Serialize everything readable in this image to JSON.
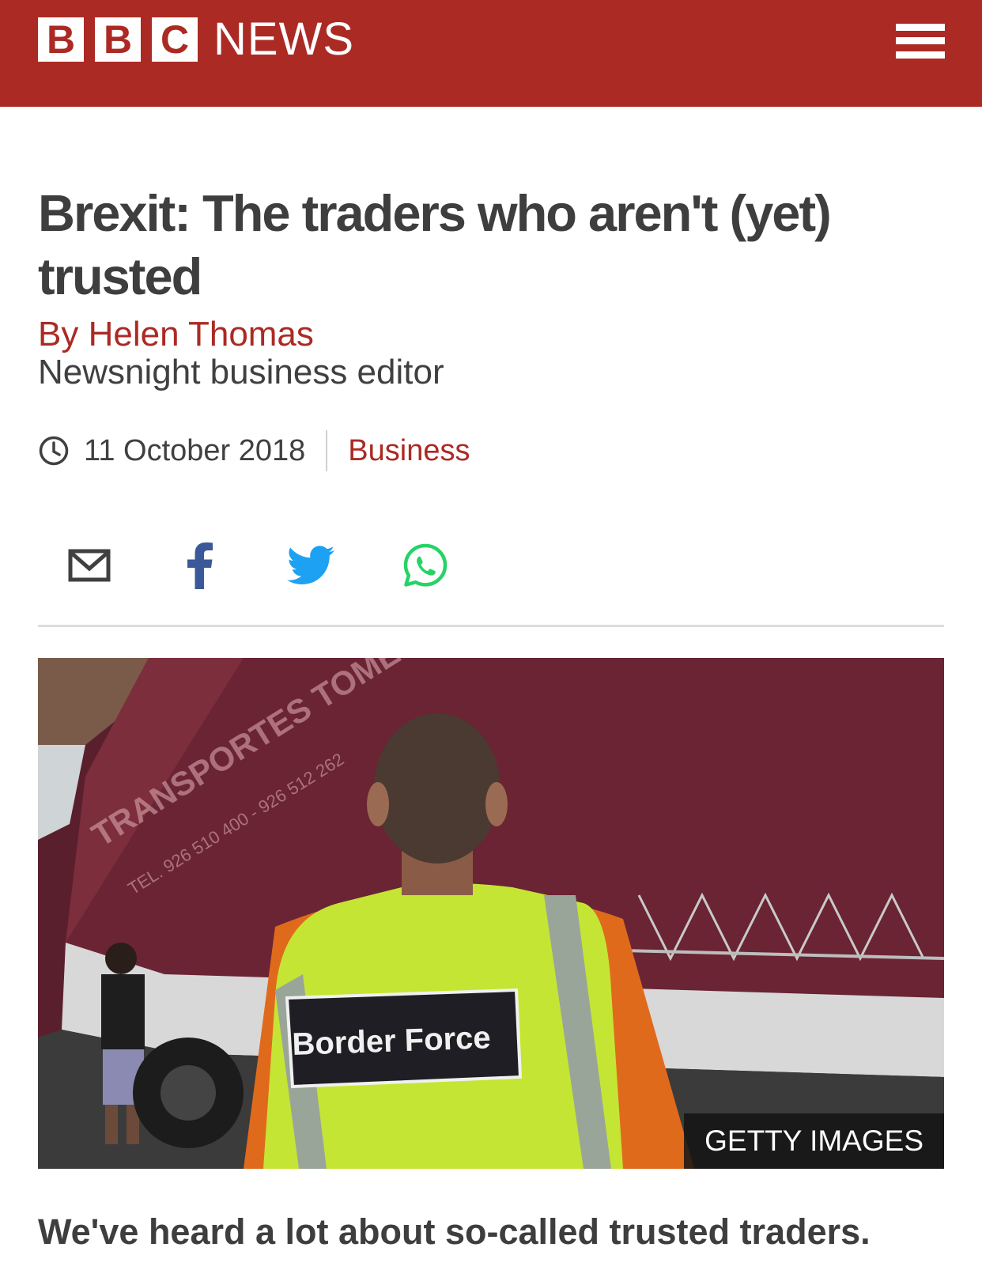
{
  "header": {
    "logo_letters": [
      "B",
      "B",
      "C"
    ],
    "logo_word": "NEWS",
    "menu_icon": "hamburger-menu-icon",
    "background_color": "#ab2a24"
  },
  "article": {
    "headline": "Brexit: The traders who aren't (yet) trusted",
    "byline": "By Helen Thomas",
    "role": "Newsnight business editor",
    "date": "11 October 2018",
    "section": "Business",
    "intro": "We've heard a lot about so-called trusted traders."
  },
  "share": {
    "icons": [
      "email-icon",
      "facebook-icon",
      "twitter-icon",
      "whatsapp-icon"
    ],
    "colors": {
      "email": "#404040",
      "facebook": "#3b5998",
      "twitter": "#1da1f2",
      "whatsapp": "#25d366"
    }
  },
  "image": {
    "credit": "GETTY IMAGES",
    "vest_text": "Border Force",
    "trailer_text": "TRANSPORTES TOMELLOSO",
    "trailer_phone": "TEL. 926 510 400 - 926 512 262"
  },
  "colors": {
    "accent": "#ab2a24",
    "text": "#3e3e3e"
  }
}
